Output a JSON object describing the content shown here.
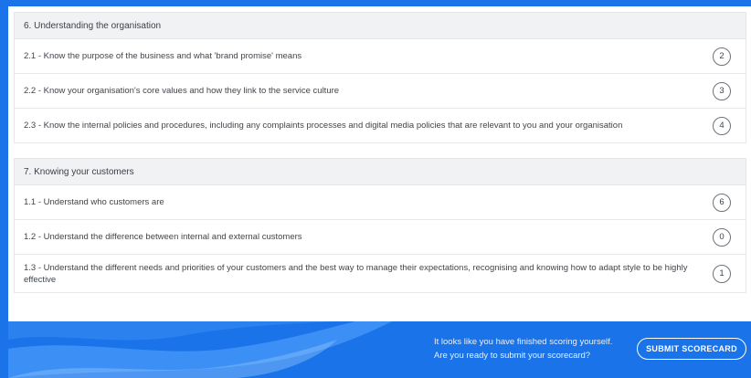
{
  "sections": [
    {
      "title": "6. Understanding the organisation",
      "items": [
        {
          "label": "2.1 - Know the purpose of the business and what 'brand promise' means",
          "score": "2"
        },
        {
          "label": "2.2 - Know your organisation's core values and how they link to the service culture",
          "score": "3"
        },
        {
          "label": "2.3 - Know the internal policies and procedures, including any complaints processes and digital media policies that are relevant to you and your organisation",
          "score": "4"
        }
      ]
    },
    {
      "title": "7. Knowing your customers",
      "items": [
        {
          "label": "1.1 - Understand who customers are",
          "score": "6"
        },
        {
          "label": "1.2 - Understand the difference between internal and external customers",
          "score": "0"
        },
        {
          "label": "1.3 - Understand the different needs and priorities of your customers and the best way to manage their expectations, recognising and knowing how to adapt style to be highly effective",
          "score": "1"
        }
      ]
    }
  ],
  "footer": {
    "message_line1": "It looks like you have finished scoring yourself.",
    "message_line2": "Are you ready to submit your scorecard?",
    "submit_label": "SUBMIT SCORECARD"
  },
  "colors": {
    "accent": "#1a73e8",
    "header_bg": "#f1f2f4"
  }
}
